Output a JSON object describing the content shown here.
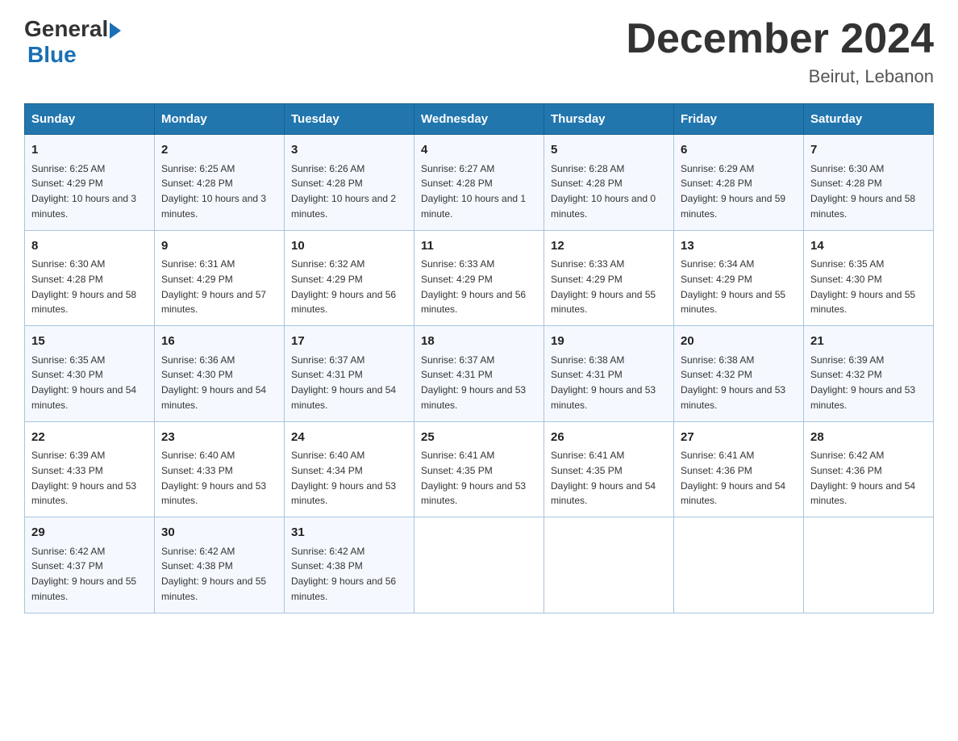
{
  "logo": {
    "general": "General",
    "blue": "Blue"
  },
  "header": {
    "month": "December 2024",
    "location": "Beirut, Lebanon"
  },
  "weekdays": [
    "Sunday",
    "Monday",
    "Tuesday",
    "Wednesday",
    "Thursday",
    "Friday",
    "Saturday"
  ],
  "weeks": [
    [
      {
        "day": "1",
        "sunrise": "6:25 AM",
        "sunset": "4:29 PM",
        "daylight": "10 hours and 3 minutes."
      },
      {
        "day": "2",
        "sunrise": "6:25 AM",
        "sunset": "4:28 PM",
        "daylight": "10 hours and 3 minutes."
      },
      {
        "day": "3",
        "sunrise": "6:26 AM",
        "sunset": "4:28 PM",
        "daylight": "10 hours and 2 minutes."
      },
      {
        "day": "4",
        "sunrise": "6:27 AM",
        "sunset": "4:28 PM",
        "daylight": "10 hours and 1 minute."
      },
      {
        "day": "5",
        "sunrise": "6:28 AM",
        "sunset": "4:28 PM",
        "daylight": "10 hours and 0 minutes."
      },
      {
        "day": "6",
        "sunrise": "6:29 AM",
        "sunset": "4:28 PM",
        "daylight": "9 hours and 59 minutes."
      },
      {
        "day": "7",
        "sunrise": "6:30 AM",
        "sunset": "4:28 PM",
        "daylight": "9 hours and 58 minutes."
      }
    ],
    [
      {
        "day": "8",
        "sunrise": "6:30 AM",
        "sunset": "4:28 PM",
        "daylight": "9 hours and 58 minutes."
      },
      {
        "day": "9",
        "sunrise": "6:31 AM",
        "sunset": "4:29 PM",
        "daylight": "9 hours and 57 minutes."
      },
      {
        "day": "10",
        "sunrise": "6:32 AM",
        "sunset": "4:29 PM",
        "daylight": "9 hours and 56 minutes."
      },
      {
        "day": "11",
        "sunrise": "6:33 AM",
        "sunset": "4:29 PM",
        "daylight": "9 hours and 56 minutes."
      },
      {
        "day": "12",
        "sunrise": "6:33 AM",
        "sunset": "4:29 PM",
        "daylight": "9 hours and 55 minutes."
      },
      {
        "day": "13",
        "sunrise": "6:34 AM",
        "sunset": "4:29 PM",
        "daylight": "9 hours and 55 minutes."
      },
      {
        "day": "14",
        "sunrise": "6:35 AM",
        "sunset": "4:30 PM",
        "daylight": "9 hours and 55 minutes."
      }
    ],
    [
      {
        "day": "15",
        "sunrise": "6:35 AM",
        "sunset": "4:30 PM",
        "daylight": "9 hours and 54 minutes."
      },
      {
        "day": "16",
        "sunrise": "6:36 AM",
        "sunset": "4:30 PM",
        "daylight": "9 hours and 54 minutes."
      },
      {
        "day": "17",
        "sunrise": "6:37 AM",
        "sunset": "4:31 PM",
        "daylight": "9 hours and 54 minutes."
      },
      {
        "day": "18",
        "sunrise": "6:37 AM",
        "sunset": "4:31 PM",
        "daylight": "9 hours and 53 minutes."
      },
      {
        "day": "19",
        "sunrise": "6:38 AM",
        "sunset": "4:31 PM",
        "daylight": "9 hours and 53 minutes."
      },
      {
        "day": "20",
        "sunrise": "6:38 AM",
        "sunset": "4:32 PM",
        "daylight": "9 hours and 53 minutes."
      },
      {
        "day": "21",
        "sunrise": "6:39 AM",
        "sunset": "4:32 PM",
        "daylight": "9 hours and 53 minutes."
      }
    ],
    [
      {
        "day": "22",
        "sunrise": "6:39 AM",
        "sunset": "4:33 PM",
        "daylight": "9 hours and 53 minutes."
      },
      {
        "day": "23",
        "sunrise": "6:40 AM",
        "sunset": "4:33 PM",
        "daylight": "9 hours and 53 minutes."
      },
      {
        "day": "24",
        "sunrise": "6:40 AM",
        "sunset": "4:34 PM",
        "daylight": "9 hours and 53 minutes."
      },
      {
        "day": "25",
        "sunrise": "6:41 AM",
        "sunset": "4:35 PM",
        "daylight": "9 hours and 53 minutes."
      },
      {
        "day": "26",
        "sunrise": "6:41 AM",
        "sunset": "4:35 PM",
        "daylight": "9 hours and 54 minutes."
      },
      {
        "day": "27",
        "sunrise": "6:41 AM",
        "sunset": "4:36 PM",
        "daylight": "9 hours and 54 minutes."
      },
      {
        "day": "28",
        "sunrise": "6:42 AM",
        "sunset": "4:36 PM",
        "daylight": "9 hours and 54 minutes."
      }
    ],
    [
      {
        "day": "29",
        "sunrise": "6:42 AM",
        "sunset": "4:37 PM",
        "daylight": "9 hours and 55 minutes."
      },
      {
        "day": "30",
        "sunrise": "6:42 AM",
        "sunset": "4:38 PM",
        "daylight": "9 hours and 55 minutes."
      },
      {
        "day": "31",
        "sunrise": "6:42 AM",
        "sunset": "4:38 PM",
        "daylight": "9 hours and 56 minutes."
      },
      null,
      null,
      null,
      null
    ]
  ]
}
